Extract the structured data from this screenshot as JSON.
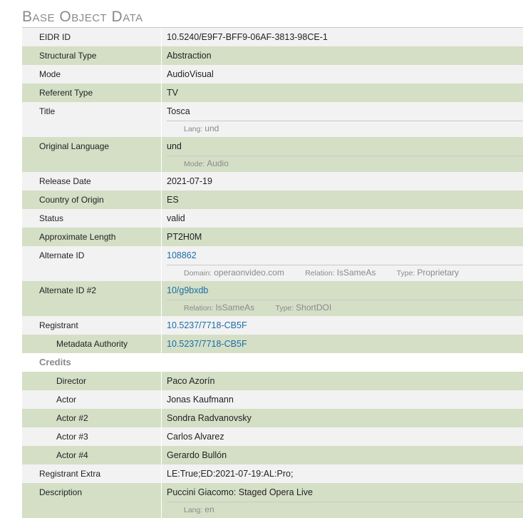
{
  "section_title": "Base Object Data",
  "fields": {
    "eidr_id": {
      "label": "EIDR ID",
      "value": "10.5240/E9F7-BFF9-06AF-3813-98CE-1"
    },
    "structural_type": {
      "label": "Structural Type",
      "value": "Abstraction"
    },
    "mode": {
      "label": "Mode",
      "value": "AudioVisual"
    },
    "referent_type": {
      "label": "Referent Type",
      "value": "TV"
    },
    "title": {
      "label": "Title",
      "value": "Tosca",
      "lang_key": "Lang:",
      "lang_value": "und"
    },
    "original_language": {
      "label": "Original Language",
      "value": "und",
      "mode_key": "Mode:",
      "mode_value": "Audio"
    },
    "release_date": {
      "label": "Release Date",
      "value": "2021-07-19"
    },
    "country_of_origin": {
      "label": "Country of Origin",
      "value": "ES"
    },
    "status": {
      "label": "Status",
      "value": "valid"
    },
    "approximate_length": {
      "label": "Approximate Length",
      "value": "PT2H0M"
    },
    "alternate_id": {
      "label": "Alternate ID",
      "value": "108862",
      "domain_key": "Domain:",
      "domain_value": "operaonvideo.com",
      "relation_key": "Relation:",
      "relation_value": "IsSameAs",
      "type_key": "Type:",
      "type_value": "Proprietary"
    },
    "alternate_id_2": {
      "label": "Alternate ID #2",
      "value": "10/g9bxdb",
      "relation_key": "Relation:",
      "relation_value": "IsSameAs",
      "type_key": "Type:",
      "type_value": "ShortDOI"
    },
    "registrant": {
      "label": "Registrant",
      "value": "10.5237/7718-CB5F"
    },
    "metadata_authority": {
      "label": "Metadata Authority",
      "value": "10.5237/7718-CB5F"
    },
    "credits_label": "Credits",
    "credits": [
      {
        "role": "Director",
        "name": "Paco Azorín"
      },
      {
        "role": "Actor",
        "name": "Jonas Kaufmann"
      },
      {
        "role": "Actor #2",
        "name": "Sondra Radvanovsky"
      },
      {
        "role": "Actor #3",
        "name": "Carlos Alvarez"
      },
      {
        "role": "Actor #4",
        "name": "Gerardo Bullón"
      }
    ],
    "registrant_extra": {
      "label": "Registrant Extra",
      "value": "LE:True;ED:2021-07-19:AL:Pro;"
    },
    "description": {
      "label": "Description",
      "value": "Puccini Giacomo: Staged Opera Live",
      "lang_key": "Lang:",
      "lang_value": "en"
    }
  },
  "colors": {
    "green_row": "#d4dfc6",
    "gray_row": "#f2f2f2",
    "link": "#1b6da8",
    "muted": "#8a8a8a"
  }
}
